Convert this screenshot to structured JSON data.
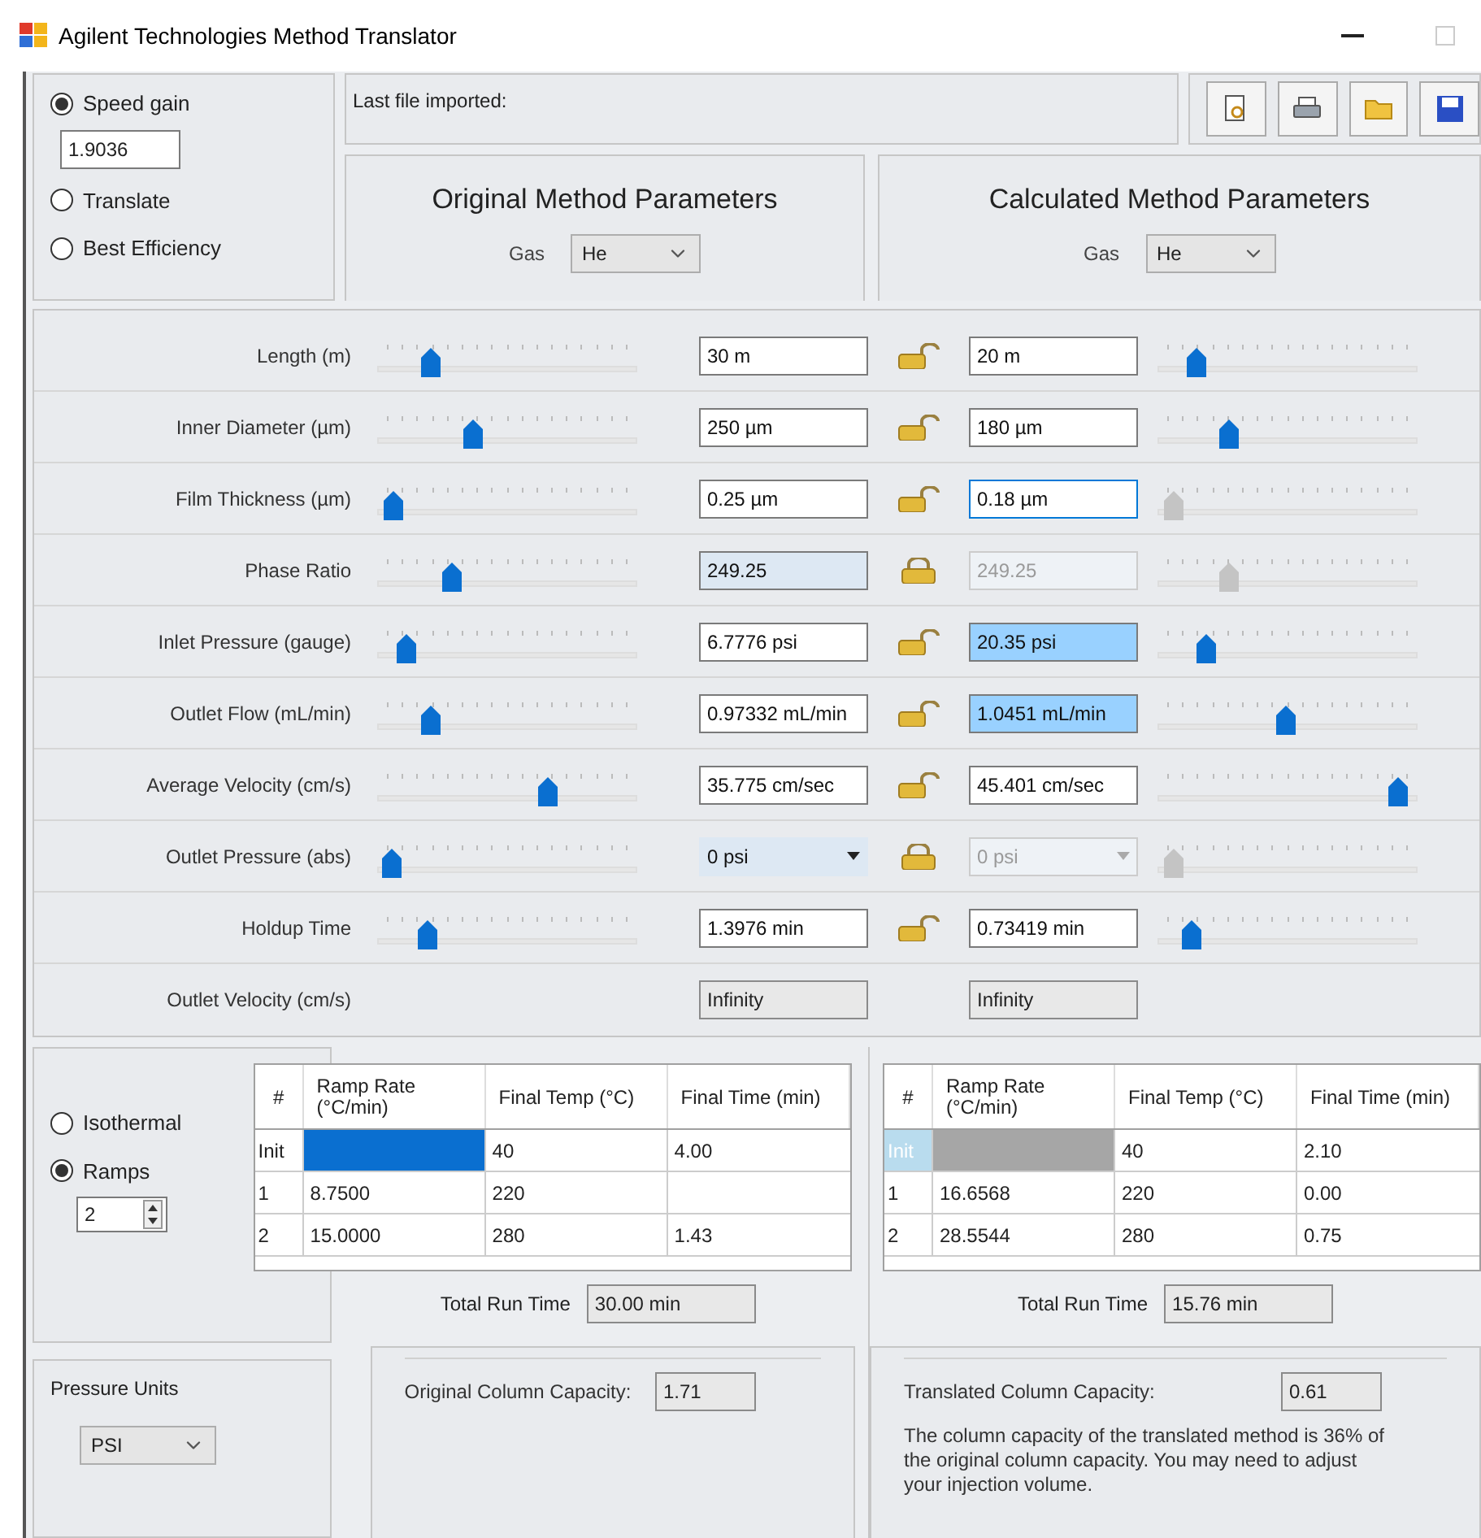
{
  "window": {
    "title": "Agilent Technologies Method Translator"
  },
  "mode_options": [
    {
      "label": "Speed gain",
      "selected": true,
      "value": "1.9036"
    },
    {
      "label": "Translate",
      "selected": false
    },
    {
      "label": "Best Efficiency",
      "selected": false
    }
  ],
  "last_file": {
    "label": "Last file imported:"
  },
  "original": {
    "title": "Original Method Parameters",
    "gas_label": "Gas",
    "gas": "He"
  },
  "calculated": {
    "title": "Calculated Method Parameters",
    "gas_label": "Gas",
    "gas": "He"
  },
  "parameters": [
    {
      "label": "Length (m)",
      "kind": "input",
      "locked": false,
      "original": {
        "value": "30 m",
        "focused": false,
        "read_only": false,
        "highlighted": false,
        "disabled": false,
        "level": 0.18,
        "slider_disabled": false
      },
      "calculated": {
        "value": "20 m",
        "focused": false,
        "read_only": false,
        "highlighted": false,
        "disabled": false,
        "level": 0.12,
        "slider_disabled": false
      }
    },
    {
      "label": "Inner Diameter (µm)",
      "kind": "input",
      "locked": false,
      "original": {
        "value": "250 µm",
        "focused": false,
        "read_only": false,
        "highlighted": false,
        "disabled": false,
        "level": 0.36,
        "slider_disabled": false
      },
      "calculated": {
        "value": "180 µm",
        "focused": false,
        "read_only": false,
        "highlighted": false,
        "disabled": false,
        "level": 0.26,
        "slider_disabled": false
      }
    },
    {
      "label": "Film Thickness (µm)",
      "kind": "input",
      "locked": false,
      "original": {
        "value": "0.25 µm",
        "focused": false,
        "read_only": false,
        "highlighted": false,
        "disabled": false,
        "level": 0.03,
        "slider_disabled": false
      },
      "calculated": {
        "value": "0.18 µm",
        "focused": true,
        "read_only": false,
        "highlighted": false,
        "disabled": false,
        "level": 0.03,
        "slider_disabled": true
      }
    },
    {
      "label": "Phase Ratio",
      "kind": "input",
      "locked": true,
      "original": {
        "value": "249.25",
        "focused": false,
        "read_only": true,
        "highlighted": false,
        "disabled": false,
        "level": 0.27,
        "slider_disabled": false
      },
      "calculated": {
        "value": "249.25",
        "focused": false,
        "read_only": false,
        "highlighted": false,
        "disabled": true,
        "level": 0.26,
        "slider_disabled": true
      }
    },
    {
      "label": "Inlet Pressure (gauge)",
      "kind": "input",
      "locked": false,
      "original": {
        "value": "6.7776 psi",
        "focused": false,
        "read_only": false,
        "highlighted": false,
        "disabled": false,
        "level": 0.08,
        "slider_disabled": false
      },
      "calculated": {
        "value": "20.35 psi",
        "focused": false,
        "read_only": false,
        "highlighted": true,
        "disabled": false,
        "level": 0.16,
        "slider_disabled": false
      }
    },
    {
      "label": "Outlet Flow (mL/min)",
      "kind": "input",
      "locked": false,
      "original": {
        "value": "0.97332 mL/min",
        "focused": false,
        "read_only": false,
        "highlighted": false,
        "disabled": false,
        "level": 0.18,
        "slider_disabled": false
      },
      "calculated": {
        "value": "1.0451 mL/min",
        "focused": false,
        "read_only": false,
        "highlighted": true,
        "disabled": false,
        "level": 0.49,
        "slider_disabled": false
      }
    },
    {
      "label": "Average Velocity (cm/s)",
      "kind": "input",
      "locked": false,
      "original": {
        "value": "35.775 cm/sec",
        "focused": false,
        "read_only": false,
        "highlighted": false,
        "disabled": false,
        "level": 0.67,
        "slider_disabled": false
      },
      "calculated": {
        "value": "45.401 cm/sec",
        "focused": false,
        "read_only": false,
        "highlighted": false,
        "disabled": false,
        "level": 0.96,
        "slider_disabled": false
      }
    },
    {
      "label": "Outlet Pressure (abs)",
      "kind": "dropdown",
      "locked": true,
      "original": {
        "value": "0 psi",
        "focused": false,
        "read_only": true,
        "highlighted": false,
        "disabled": false,
        "level": 0.02,
        "slider_disabled": false
      },
      "calculated": {
        "value": "0 psi",
        "focused": false,
        "read_only": false,
        "highlighted": false,
        "disabled": true,
        "level": 0.03,
        "slider_disabled": true
      }
    },
    {
      "label": "Holdup Time",
      "kind": "input",
      "locked": false,
      "original": {
        "value": "1.3976 min",
        "focused": false,
        "read_only": false,
        "highlighted": false,
        "disabled": false,
        "level": 0.17,
        "slider_disabled": false
      },
      "calculated": {
        "value": "0.73419 min",
        "focused": false,
        "read_only": false,
        "highlighted": false,
        "disabled": false,
        "level": 0.1,
        "slider_disabled": false
      }
    },
    {
      "label": "Outlet Velocity (cm/s)",
      "kind": "output",
      "original": {
        "value": "Infinity"
      },
      "calculated": {
        "value": "Infinity"
      }
    }
  ],
  "temperature_modes": [
    {
      "label": "Isothermal",
      "selected": false
    },
    {
      "label": "Ramps",
      "selected": true
    }
  ],
  "ramp_count": "2",
  "tables": [
    {
      "columns": [
        "#",
        "Ramp Rate\n(°C/min)",
        "Final Temp (°C)",
        "Final Time (min)"
      ],
      "rows": [
        {
          "label": "Init",
          "final_temp": "40",
          "final_time": "4.00",
          "selected": true,
          "disabled": false
        },
        {
          "label": "1",
          "ramp_rate": "8.7500",
          "final_temp": "220",
          "selected": false,
          "disabled": false
        },
        {
          "label": "2",
          "ramp_rate": "15.0000",
          "final_temp": "280",
          "final_time": "1.43",
          "selected": false,
          "disabled": false
        }
      ],
      "run_time_label": "Total Run Time",
      "run_time": "30.00 min",
      "capacity_label": "Original Column Capacity:",
      "capacity": "1.71"
    },
    {
      "columns": [
        "#",
        "Ramp Rate\n(°C/min)",
        "Final Temp (°C)",
        "Final Time (min)"
      ],
      "rows": [
        {
          "label": "Init",
          "final_temp": "40",
          "final_time": "2.10",
          "selected": false,
          "disabled": true
        },
        {
          "label": "1",
          "ramp_rate": "16.6568",
          "final_temp": "220",
          "final_time": "0.00",
          "selected": false,
          "disabled": false
        },
        {
          "label": "2",
          "ramp_rate": "28.5544",
          "final_temp": "280",
          "final_time": "0.75",
          "selected": false,
          "disabled": false
        }
      ],
      "run_time_label": "Total Run Time",
      "run_time": "15.76 min",
      "capacity_label": "Translated Column Capacity:",
      "capacity": "0.61",
      "note": "The column capacity of the translated method is 36% of the original column capacity.  You may need to adjust your injection volume."
    }
  ],
  "pressure_units": {
    "label": "Pressure Units",
    "value": "PSI"
  }
}
